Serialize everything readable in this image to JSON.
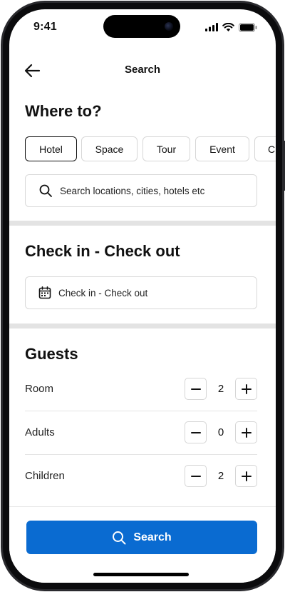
{
  "status_bar": {
    "time": "9:41"
  },
  "header": {
    "title": "Search"
  },
  "where": {
    "title": "Where to?",
    "categories": [
      {
        "label": "Hotel",
        "selected": true
      },
      {
        "label": "Space",
        "selected": false
      },
      {
        "label": "Tour",
        "selected": false
      },
      {
        "label": "Event",
        "selected": false
      },
      {
        "label": "C",
        "selected": false
      }
    ],
    "search_placeholder": "Search locations, cities, hotels etc"
  },
  "dates": {
    "title": "Check in - Check out",
    "field_label": "Check in - Check out"
  },
  "guests": {
    "title": "Guests",
    "rows": [
      {
        "label": "Room",
        "value": "2"
      },
      {
        "label": "Adults",
        "value": "0"
      },
      {
        "label": "Children",
        "value": "2"
      }
    ]
  },
  "footer": {
    "search_label": "Search"
  },
  "colors": {
    "primary": "#0a6bd1",
    "divider": "#e3e3e3"
  },
  "icons": {
    "back": "arrow-left",
    "search": "magnifier",
    "calendar": "calendar",
    "minus": "minus",
    "plus": "plus"
  }
}
